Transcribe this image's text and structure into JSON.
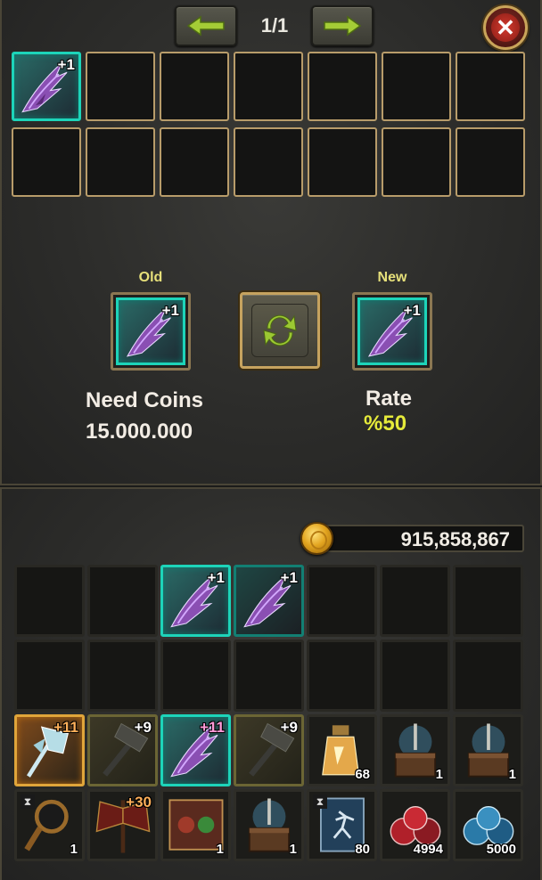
{
  "pager": {
    "label": "1/1",
    "prev_icon": "arrow-left-icon",
    "next_icon": "arrow-right-icon"
  },
  "close_icon": "close-icon",
  "top_slots": [
    {
      "item": "claw-weapon",
      "plus": "+1"
    }
  ],
  "upgrade": {
    "old_label": "Old",
    "new_label": "New",
    "old_item": {
      "item": "claw-weapon",
      "plus": "+1"
    },
    "new_item": {
      "item": "claw-weapon",
      "plus": "+1"
    },
    "swap_icon": "refresh-icon",
    "need_coins_label": "Need Coins",
    "need_coins_value": "15.000.000",
    "rate_label": "Rate",
    "rate_value": "%50"
  },
  "coins": {
    "value": "915,858,867",
    "icon": "gold-coin-icon"
  },
  "inventory": [
    {
      "slot": 0,
      "empty": true
    },
    {
      "slot": 1,
      "empty": true
    },
    {
      "slot": 2,
      "item": "claw-weapon",
      "plus": "+1",
      "frame": "teal"
    },
    {
      "slot": 3,
      "item": "claw-weapon",
      "plus": "+1",
      "frame": "darkteal"
    },
    {
      "slot": 4,
      "empty": true
    },
    {
      "slot": 5,
      "empty": true
    },
    {
      "slot": 6,
      "empty": true
    },
    {
      "slot": 7,
      "empty": true
    },
    {
      "slot": 8,
      "empty": true
    },
    {
      "slot": 9,
      "empty": true
    },
    {
      "slot": 10,
      "empty": true
    },
    {
      "slot": 11,
      "empty": true
    },
    {
      "slot": 12,
      "empty": true
    },
    {
      "slot": 13,
      "empty": true
    },
    {
      "slot": 14,
      "item": "ice-axe",
      "plus": "+11",
      "frame": "gold"
    },
    {
      "slot": 15,
      "item": "dark-hammer",
      "plus": "+9",
      "frame": "olive"
    },
    {
      "slot": 16,
      "item": "claw-weapon",
      "plus": "+11",
      "frame": "teal"
    },
    {
      "slot": 17,
      "item": "dark-hammer",
      "plus": "+9",
      "frame": "olive"
    },
    {
      "slot": 18,
      "item": "potion-bottle",
      "qty": "68",
      "frame": "plain"
    },
    {
      "slot": 19,
      "item": "anvil-chest",
      "qty": "1",
      "frame": "plain"
    },
    {
      "slot": 20,
      "item": "anvil-chest",
      "qty": "1",
      "frame": "plain"
    },
    {
      "slot": 21,
      "item": "magnifier",
      "qty": "1",
      "frame": "plain",
      "timed": true
    },
    {
      "slot": 22,
      "item": "red-axe",
      "plus": "+30",
      "frame": "plain"
    },
    {
      "slot": 23,
      "item": "scroll-faces",
      "qty": "1",
      "frame": "plain"
    },
    {
      "slot": 24,
      "item": "anvil-chest",
      "qty": "1",
      "frame": "plain"
    },
    {
      "slot": 25,
      "item": "running-scroll",
      "qty": "80",
      "frame": "plain",
      "timed": true
    },
    {
      "slot": 26,
      "item": "red-potions",
      "qty": "4994",
      "frame": "plain"
    },
    {
      "slot": 27,
      "item": "blue-potions",
      "qty": "5000",
      "frame": "plain"
    }
  ],
  "colors": {
    "teal_frame": "#1dd4b9",
    "gold_frame": "#e0a53a",
    "rate": "#e5ea3a",
    "panel_border": "#4a4537"
  }
}
